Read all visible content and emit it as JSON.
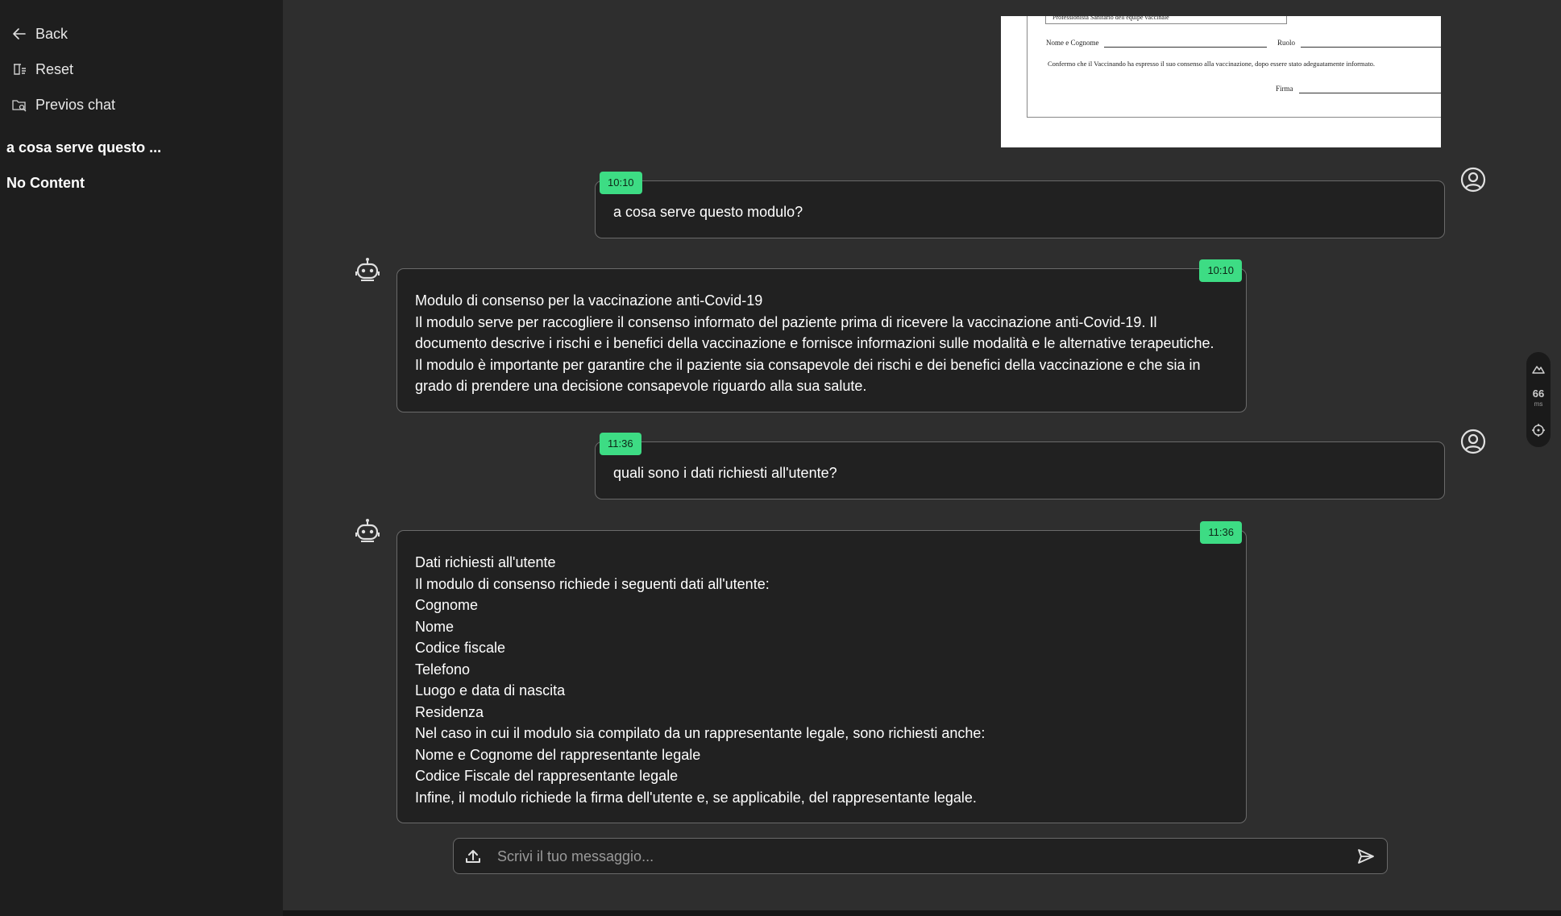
{
  "sidebar": {
    "back_label": "Back",
    "reset_label": "Reset",
    "previous_label": "Previos chat",
    "chat_title": "a cosa serve questo ...",
    "no_content": "No Content"
  },
  "doc_preview": {
    "box_text": "Professionista Sanitario dell'équipe vaccinale",
    "name_label": "Nome e Cognome",
    "role_label": "Ruolo",
    "sentence": "Confermo che il Vaccinando ha espresso il suo consenso alla vaccinazione, dopo essere stato adeguatamente informato.",
    "signature_label": "Firma"
  },
  "messages": [
    {
      "role": "user",
      "time": "10:10",
      "lines": [
        "a cosa serve questo modulo?"
      ]
    },
    {
      "role": "bot",
      "time": "10:10",
      "lines": [
        "Modulo di consenso per la vaccinazione anti-Covid-19",
        "Il modulo serve per raccogliere il consenso informato del paziente prima di ricevere la vaccinazione anti-Covid-19. Il",
        "documento descrive i rischi e i benefici della vaccinazione e fornisce informazioni sulle modalità e le alternative terapeutiche.",
        "Il modulo è importante per garantire che il paziente sia consapevole dei rischi e dei benefici della vaccinazione e che sia in",
        "grado di prendere una decisione consapevole riguardo alla sua salute."
      ]
    },
    {
      "role": "user",
      "time": "11:36",
      "lines": [
        "quali sono i dati richiesti all'utente?"
      ]
    },
    {
      "role": "bot",
      "time": "11:36",
      "lines": [
        "Dati richiesti all'utente",
        "Il modulo di consenso richiede i seguenti dati all'utente:",
        "Cognome",
        "Nome",
        "Codice fiscale",
        "Telefono",
        "Luogo e data di nascita",
        "Residenza",
        "Nel caso in cui il modulo sia compilato da un rappresentante legale, sono richiesti anche:",
        "Nome e Cognome del rappresentante legale",
        "Codice Fiscale del rappresentante legale",
        "Infine, il modulo richiede la firma dell'utente e, se applicabile, del rappresentante legale."
      ]
    }
  ],
  "composer": {
    "placeholder": "Scrivi il tuo messaggio..."
  },
  "perf_widget": {
    "value": "66",
    "unit": "ms"
  },
  "colors": {
    "accent": "#3ddc84",
    "sidebar_bg": "#1e1e1e",
    "main_bg": "#2e2e2e",
    "bubble_bg": "#212121",
    "bubble_border": "#6a6a6a"
  },
  "icons": {
    "back": "arrow-left-icon",
    "reset": "reset-icon",
    "previous": "folder-search-icon",
    "user_avatar": "user-circle-icon",
    "bot_avatar": "robot-icon",
    "upload": "upload-icon",
    "send": "send-icon"
  }
}
